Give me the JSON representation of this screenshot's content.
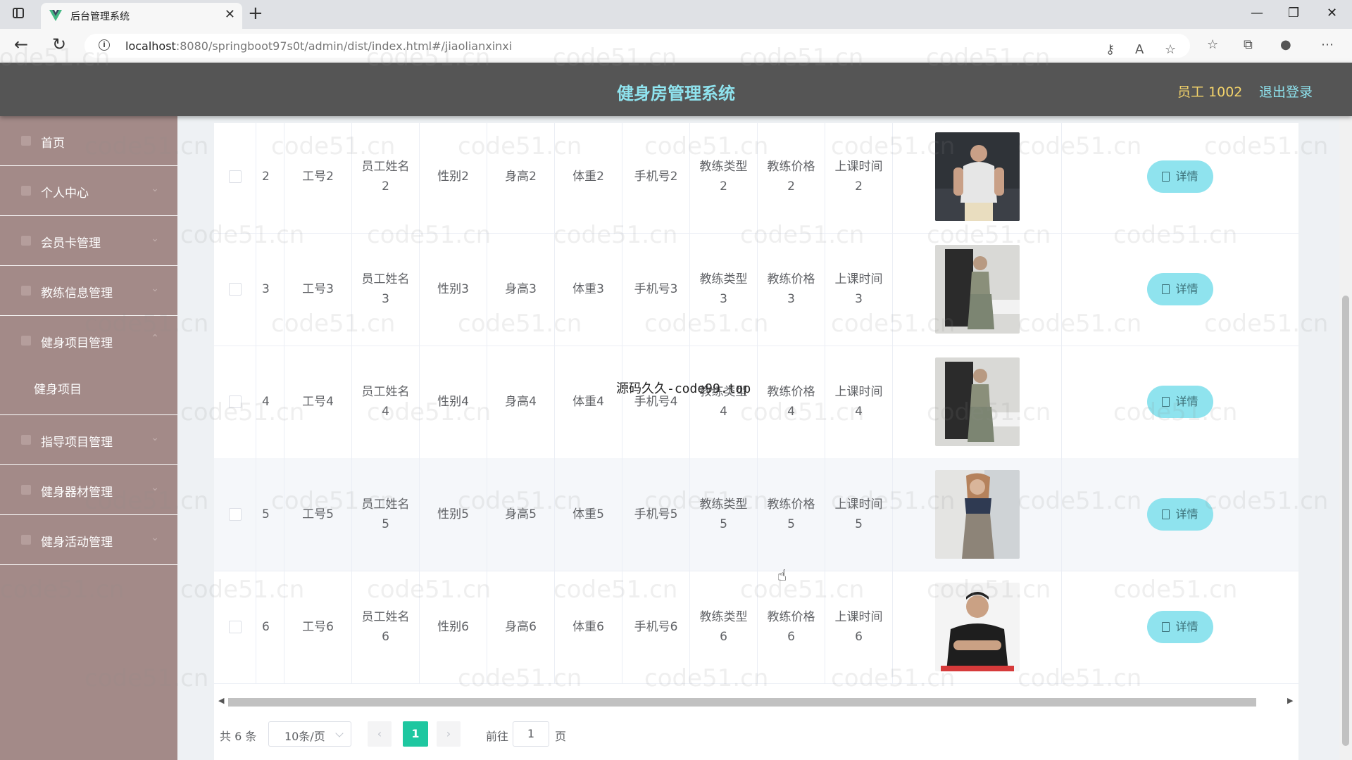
{
  "browser": {
    "tab_title": "后台管理系统",
    "url_host": "localhost",
    "url_rest": ":8080/springboot97s0t/admin/dist/index.html#/jiaolianxinxi"
  },
  "header": {
    "title": "健身房管理系统",
    "user": "员工 1002",
    "logout": "退出登录"
  },
  "sidebar": {
    "items": [
      {
        "label": "首页"
      },
      {
        "label": "个人中心"
      },
      {
        "label": "会员卡管理"
      },
      {
        "label": "教练信息管理"
      },
      {
        "label": "健身项目管理"
      },
      {
        "label": "指导项目管理"
      },
      {
        "label": "健身器材管理"
      },
      {
        "label": "健身活动管理"
      }
    ],
    "subitem": "健身项目"
  },
  "table": {
    "detail_label": "详情",
    "rows": [
      {
        "id": "2",
        "gonghao": "工号2",
        "name1": "员工姓名",
        "name2": "2",
        "sex": "性别2",
        "height": "身高2",
        "weight": "体重2",
        "phone": "手机号2",
        "type1": "教练类型",
        "type2": "2",
        "price1": "教练价格",
        "price2": "2",
        "time1": "上课时间",
        "time2": "2"
      },
      {
        "id": "3",
        "gonghao": "工号3",
        "name1": "员工姓名",
        "name2": "3",
        "sex": "性别3",
        "height": "身高3",
        "weight": "体重3",
        "phone": "手机号3",
        "type1": "教练类型",
        "type2": "3",
        "price1": "教练价格",
        "price2": "3",
        "time1": "上课时间",
        "time2": "3"
      },
      {
        "id": "4",
        "gonghao": "工号4",
        "name1": "员工姓名",
        "name2": "4",
        "sex": "性别4",
        "height": "身高4",
        "weight": "体重4",
        "phone": "手机号4",
        "type1": "教练类型",
        "type2": "4",
        "price1": "教练价格",
        "price2": "4",
        "time1": "上课时间",
        "time2": "4"
      },
      {
        "id": "5",
        "gonghao": "工号5",
        "name1": "员工姓名",
        "name2": "5",
        "sex": "性别5",
        "height": "身高5",
        "weight": "体重5",
        "phone": "手机号5",
        "type1": "教练类型",
        "type2": "5",
        "price1": "教练价格",
        "price2": "5",
        "time1": "上课时间",
        "time2": "5"
      },
      {
        "id": "6",
        "gonghao": "工号6",
        "name1": "员工姓名",
        "name2": "6",
        "sex": "性别6",
        "height": "身高6",
        "weight": "体重6",
        "phone": "手机号6",
        "type1": "教练类型",
        "type2": "6",
        "price1": "教练价格",
        "price2": "6",
        "time1": "上课时间",
        "time2": "6"
      }
    ]
  },
  "pagination": {
    "total": "共 6 条",
    "page_size": "10条/页",
    "current_page": "1",
    "goto_label": "前往",
    "goto_value": "1",
    "page_unit": "页"
  },
  "overlay_text": "源码久久-code99.top",
  "watermark": "code51.cn",
  "colors": {
    "header_bg": "#555555",
    "sidebar_bg": "#a38a88",
    "accent_cyan": "#8fe3ee",
    "user_yellow": "#f3d36a",
    "page_active": "#1ec7a0"
  }
}
